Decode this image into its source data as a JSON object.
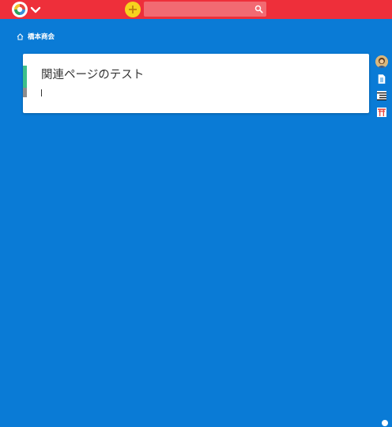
{
  "header": {
    "logo_icon": "scrapbox-logo-icon",
    "menu_icon": "chevron-down-icon",
    "add_icon": "plus-icon",
    "search_placeholder": "",
    "search_icon": "search-icon",
    "colors": {
      "bar": "#ee2f3a",
      "add_button": "#f7d21e"
    }
  },
  "breadcrumb": {
    "icon": "home-icon",
    "project": "橋本商会"
  },
  "page": {
    "title": "関連ページのテスト",
    "body": ""
  },
  "sidebar": {
    "items": [
      {
        "icon": "user-avatar-icon"
      },
      {
        "icon": "document-icon"
      },
      {
        "icon": "list-icon"
      },
      {
        "icon": "torii-icon"
      }
    ]
  },
  "footer": {
    "status_icon": "check-circle-icon"
  },
  "colors": {
    "background": "#0a7bd6",
    "card": "#ffffff",
    "strip": "#3dbf8a"
  }
}
